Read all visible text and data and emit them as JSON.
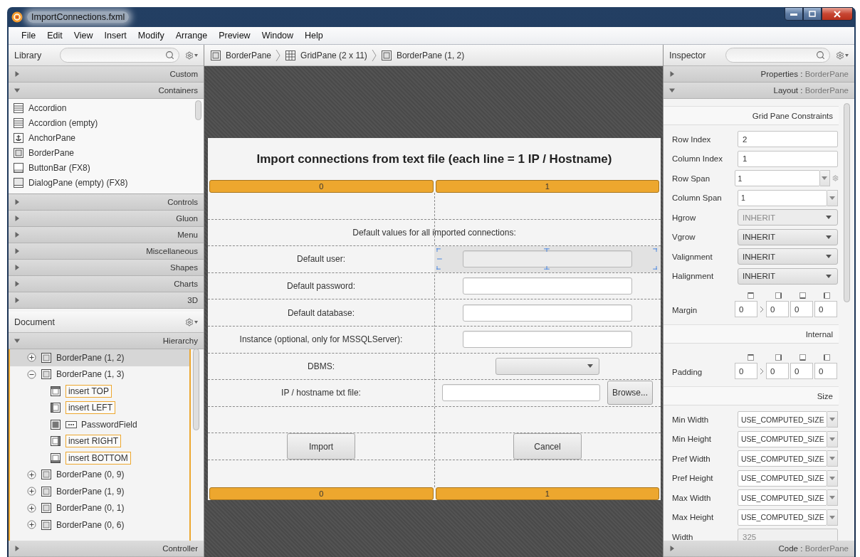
{
  "window": {
    "title": "ImportConnections.fxml"
  },
  "menu": [
    "File",
    "Edit",
    "View",
    "Insert",
    "Modify",
    "Arrange",
    "Preview",
    "Window",
    "Help"
  ],
  "library": {
    "title": "Library",
    "sections": [
      {
        "label": "Custom",
        "expanded": false
      },
      {
        "label": "Containers",
        "expanded": true,
        "items": [
          {
            "label": "Accordion",
            "kind": "accordion"
          },
          {
            "label": "Accordion (empty)",
            "kind": "accordion"
          },
          {
            "label": "AnchorPane",
            "kind": "anchor"
          },
          {
            "label": "BorderPane",
            "kind": "border"
          },
          {
            "label": "ButtonBar (FX8)",
            "kind": "buttonbar"
          },
          {
            "label": "DialogPane (empty) (FX8)",
            "kind": "dialog"
          }
        ]
      },
      {
        "label": "Controls",
        "expanded": false
      },
      {
        "label": "Gluon",
        "expanded": false
      },
      {
        "label": "Menu",
        "expanded": false
      },
      {
        "label": "Miscellaneous",
        "expanded": false
      },
      {
        "label": "Shapes",
        "expanded": false
      },
      {
        "label": "Charts",
        "expanded": false
      },
      {
        "label": "3D",
        "expanded": false
      }
    ]
  },
  "document": {
    "title": "Document",
    "section": {
      "label": "Hierarchy",
      "expanded": true
    },
    "tree": [
      {
        "label": "BorderPane (1, 2)",
        "expanded": false,
        "selected": true
      },
      {
        "label": "BorderPane (1, 3)",
        "expanded": true,
        "selected": false,
        "children": [
          {
            "label": "insert TOP",
            "kind": "top"
          },
          {
            "label": "insert LEFT",
            "kind": "left"
          },
          {
            "label": "PasswordField",
            "kind": "center"
          },
          {
            "label": "insert RIGHT",
            "kind": "right"
          },
          {
            "label": "insert BOTTOM",
            "kind": "bottom"
          }
        ]
      },
      {
        "label": "BorderPane (0, 9)",
        "expanded": false,
        "selected": false
      },
      {
        "label": "BorderPane (1, 9)",
        "expanded": false,
        "selected": false
      },
      {
        "label": "BorderPane (0, 1)",
        "expanded": false,
        "selected": false
      },
      {
        "label": "BorderPane (0, 6)",
        "expanded": false,
        "selected": false
      }
    ]
  },
  "controller": {
    "label": "Controller",
    "expanded": false
  },
  "breadcrumb": [
    {
      "label": "BorderPane",
      "kind": "border"
    },
    {
      "label": "GridPane (2 x 11)",
      "kind": "grid"
    },
    {
      "label": "BorderPane (1, 2)",
      "kind": "border"
    }
  ],
  "form": {
    "title": "Import connections from text file (each line = 1 IP / Hostname)",
    "top_headers": [
      "0",
      "1"
    ],
    "rows": [
      {
        "kind": "empty"
      },
      {
        "kind": "heading",
        "label": "Default values for all imported connections:"
      },
      {
        "kind": "field",
        "label": "Default user:",
        "selected": true
      },
      {
        "kind": "field",
        "label": "Default password:",
        "selected": false
      },
      {
        "kind": "field",
        "label": "Default database:",
        "selected": false
      },
      {
        "kind": "field",
        "label": "Instance (optional, only for MSSQLServer):",
        "selected": false
      },
      {
        "kind": "select",
        "label": "DBMS:"
      },
      {
        "kind": "file",
        "label": "IP / hostname txt file:",
        "button": "Browse..."
      },
      {
        "kind": "empty"
      },
      {
        "kind": "buttons",
        "buttons": [
          "Import",
          "Cancel"
        ]
      },
      {
        "kind": "empty"
      }
    ],
    "bottom_headers": [
      "0",
      "1"
    ]
  },
  "inspector": {
    "title": "Inspector",
    "sections": [
      {
        "label": "Properties",
        "separator": ":",
        "target": "BorderPane",
        "expanded": false
      },
      {
        "label": "Layout",
        "separator": ":",
        "target": "BorderPane",
        "expanded": true
      }
    ],
    "groups": [
      {
        "title": "Grid Pane Constraints",
        "properties": [
          {
            "label": "Row Index",
            "kind": "text",
            "value": "2",
            "disabled": false,
            "reset_gear": false
          },
          {
            "label": "Column Index",
            "kind": "text",
            "value": "1",
            "disabled": false,
            "reset_gear": false
          },
          {
            "label": "Row Span",
            "kind": "combo",
            "value": "1",
            "disabled": false,
            "reset_gear": true
          },
          {
            "label": "Column Span",
            "kind": "combo",
            "value": "1",
            "disabled": false,
            "reset_gear": false
          },
          {
            "label": "Hgrow",
            "kind": "choice",
            "value": "INHERIT",
            "disabled": true,
            "reset_gear": false
          },
          {
            "label": "Vgrow",
            "kind": "choice",
            "value": "INHERIT",
            "disabled": false,
            "reset_gear": false
          },
          {
            "label": "Valignment",
            "kind": "choice",
            "value": "INHERIT",
            "disabled": false,
            "reset_gear": false
          },
          {
            "label": "Halignment",
            "kind": "choice",
            "value": "INHERIT",
            "disabled": false,
            "reset_gear": false
          },
          {
            "label": "Margin",
            "kind": "insets",
            "values": [
              "0",
              "0",
              "0",
              "0"
            ]
          }
        ]
      },
      {
        "title": "Internal",
        "properties": [
          {
            "label": "Padding",
            "kind": "insets",
            "values": [
              "0",
              "0",
              "0",
              "0"
            ]
          }
        ]
      },
      {
        "title": "Size",
        "properties": [
          {
            "label": "Min Width",
            "kind": "combo",
            "value": "USE_COMPUTED_SIZE",
            "disabled": false,
            "reset_gear": false
          },
          {
            "label": "Min Height",
            "kind": "combo",
            "value": "USE_COMPUTED_SIZE",
            "disabled": false,
            "reset_gear": false
          },
          {
            "label": "Pref Width",
            "kind": "combo",
            "value": "USE_COMPUTED_SIZE",
            "disabled": false,
            "reset_gear": false
          },
          {
            "label": "Pref Height",
            "kind": "combo",
            "value": "USE_COMPUTED_SIZE",
            "disabled": false,
            "reset_gear": false
          },
          {
            "label": "Max Width",
            "kind": "combo",
            "value": "USE_COMPUTED_SIZE",
            "disabled": false,
            "reset_gear": false
          },
          {
            "label": "Max Height",
            "kind": "combo",
            "value": "USE_COMPUTED_SIZE",
            "disabled": false,
            "reset_gear": false
          },
          {
            "label": "Width",
            "kind": "text",
            "value": "325",
            "disabled": true,
            "reset_gear": false
          }
        ]
      }
    ],
    "footer": {
      "label": "Code",
      "separator": ":",
      "target": "BorderPane",
      "expanded": false
    }
  }
}
